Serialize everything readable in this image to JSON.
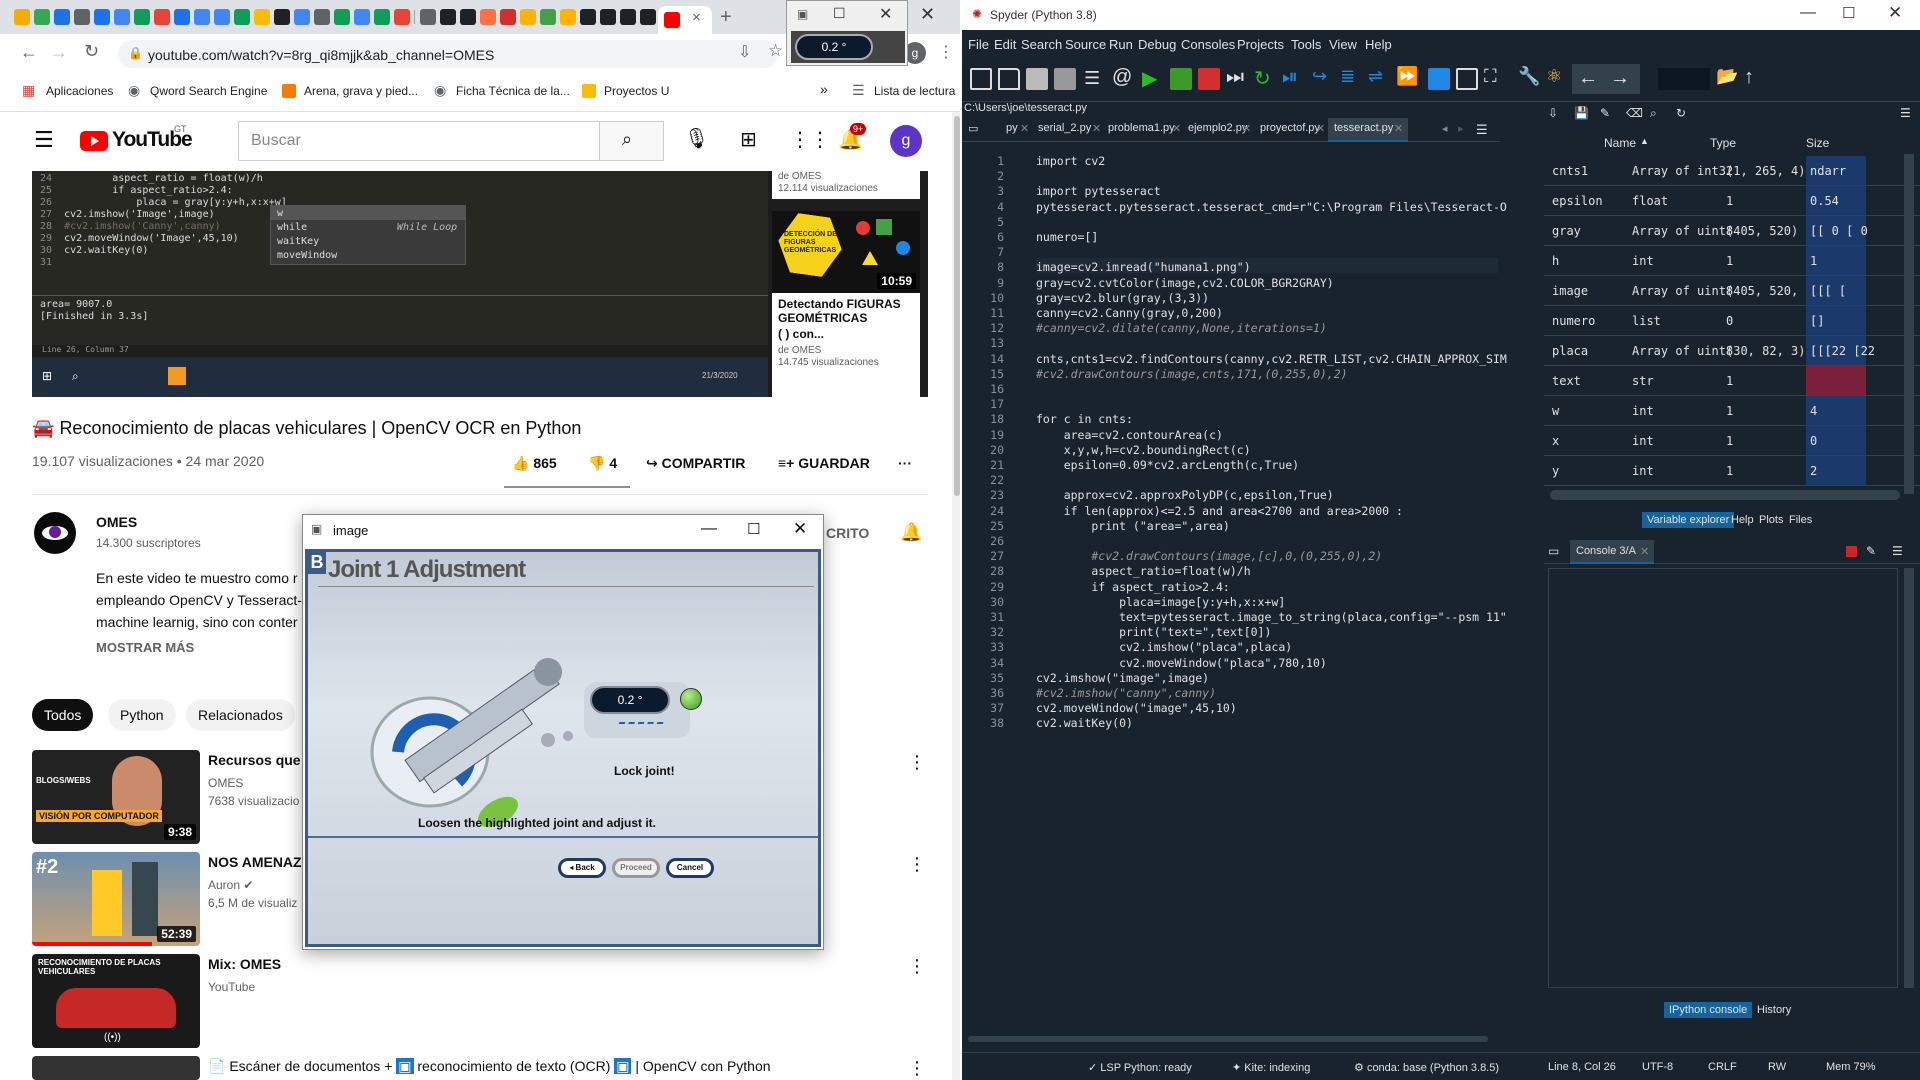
{
  "chrome": {
    "url": "youtube.com/watch?v=8rg_qi8mjjk&ab_channel=OMES",
    "bookmarks": [
      "Aplicaciones",
      "Qword Search Engine",
      "Arena, grava y pied...",
      "Ficha Técnica de la...",
      "Proyectos U",
      "Lista de lectura"
    ],
    "bookmarks_more": "»"
  },
  "youtube": {
    "logo": "YouTube",
    "logo_region": "GT",
    "search_placeholder": "Buscar",
    "notif_badge": "9+",
    "avatar_letter": "g",
    "video_title": "Reconocimiento de placas vehiculares | OpenCV OCR en Python",
    "views_date": "19.107 visualizaciones • 24 mar 2020",
    "likes": "865",
    "dislikes": "4",
    "share": "COMPARTIR",
    "save": "GUARDAR",
    "channel_name": "OMES",
    "subscribers": "14.300 suscriptores",
    "subscribe_tail": "CRITO",
    "description": [
      "En este video te muestro como r",
      "empleando OpenCV y Tesseract-",
      "machine learnig, sino con conter"
    ],
    "show_more": "MOSTRAR MÁS",
    "chips": [
      "Todos",
      "Python",
      "Relacionados"
    ],
    "video_editor": {
      "lines": [
        {
          "n": "24",
          "text": "        aspect_ratio = float(w)/h"
        },
        {
          "n": "25",
          "text": "        if aspect_ratio>2.4:"
        },
        {
          "n": "26",
          "text": "            placa = gray[y:y+h,x:x+w]"
        },
        {
          "n": "27",
          "text": "cv2.imshow('Image',image)"
        },
        {
          "n": "28",
          "text": "#cv2.imshow('Canny',canny)"
        },
        {
          "n": "29",
          "text": "cv2.moveWindow('Image',45,10)"
        },
        {
          "n": "30",
          "text": "cv2.waitKey(0)"
        },
        {
          "n": "31",
          "text": ""
        }
      ],
      "autocomplete": [
        "w",
        "while",
        "waitKey",
        "moveWindow"
      ],
      "autocomplete_hint": "While Loop",
      "console": [
        "area= 9007.0",
        "[Finished in 3.3s]"
      ],
      "status": "Line 26, Column 37",
      "clock": "21/3/2020"
    },
    "video_cards": [
      {
        "channel": "de OMES",
        "views": "12.114 visualizaciones"
      },
      {
        "title": "Detectando FIGURAS GEOMÉTRICAS",
        "title2": "( ) con...",
        "channel": "de OMES",
        "views": "14.745 visualizaciones",
        "duration": "10:59",
        "thumb_text": "DETECCIÓN DE FIGURAS GEOMÉTRICAS"
      }
    ],
    "recommendations": [
      {
        "title": "Recursos que l",
        "channel": "OMES",
        "meta": "7638 visualizacio",
        "duration": "9:38",
        "thumb_text": "VISIÓN POR COMPUTADOR"
      },
      {
        "title": "NOS AMENAZ",
        "channel": "Auron",
        "meta": "6,5 M de visualiz",
        "duration": "52:39",
        "thumb_text": "#2"
      },
      {
        "title": "Mix: OMES",
        "channel": "YouTube",
        "meta": "",
        "duration": "",
        "thumb_text": "RECONOCIMIENTO DE PLACAS VEHICULARES"
      },
      {
        "title": "Escáner de documentos + ",
        "title_mid": " reconocimiento de texto (OCR) ",
        "title_end": " | OpenCV con Python"
      }
    ]
  },
  "mini_window": {
    "readout": "0.2 °"
  },
  "image_window": {
    "title": "image",
    "step_letter": "B",
    "heading": "Joint 1 Adjustment",
    "readout": "0.2 °",
    "lock_text": "Lock joint!",
    "instruction": "Loosen the highlighted joint and adjust it.",
    "buttons": [
      "◂ Back",
      "Proceed",
      "Cancel"
    ]
  },
  "spyder": {
    "title": "Spyder (Python 3.8)",
    "menu": [
      "File",
      "Edit",
      "Search",
      "Source",
      "Run",
      "Debug",
      "Consoles",
      "Projects",
      "Tools",
      "View",
      "Help"
    ],
    "path": "C:\\Users\\joe\\tesseract.py",
    "tabs": [
      "py",
      "serial_2.py",
      "problema1.py",
      "ejemplo2.py",
      "proyectof.py",
      "tesseract.py"
    ],
    "code": [
      "import cv2",
      "",
      "import pytesseract",
      "pytesseract.pytesseract.tesseract_cmd=r\"C:\\Program Files\\Tesseract-O",
      "",
      "numero=[]",
      "",
      "image=cv2.imread(\"humana1.png\")",
      "gray=cv2.cvtColor(image,cv2.COLOR_BGR2GRAY)",
      "gray=cv2.blur(gray,(3,3))",
      "canny=cv2.Canny(gray,0,200)",
      "#canny=cv2.dilate(canny,None,iterations=1)",
      "",
      "cnts,cnts1=cv2.findContours(canny,cv2.RETR_LIST,cv2.CHAIN_APPROX_SIM",
      "#cv2.drawContours(image,cnts,171,(0,255,0),2)",
      "",
      "",
      "for c in cnts:",
      "    area=cv2.contourArea(c)",
      "    x,y,w,h=cv2.boundingRect(c)",
      "    epsilon=0.09*cv2.arcLength(c,True)",
      "",
      "    approx=cv2.approxPolyDP(c,epsilon,True)",
      "    if len(approx)<=2.5 and area<2700 and area>2000 :",
      "        print (\"area=\",area)",
      "",
      "        #cv2.drawContours(image,[c],0,(0,255,0),2)",
      "        aspect_ratio=float(w)/h",
      "        if aspect_ratio>2.4:",
      "            placa=image[y:y+h,x:x+w]",
      "            text=pytesseract.image_to_string(placa,config=\"--psm 11\"",
      "            print(\"text=\",text[0])",
      "            cv2.imshow(\"placa\",placa)",
      "            cv2.moveWindow(\"placa\",780,10)",
      "cv2.imshow(\"image\",image)",
      "#cv2.imshow(\"canny\",canny)",
      "cv2.moveWindow(\"image\",45,10)",
      "cv2.waitKey(0)"
    ],
    "var_headers": [
      "Name",
      "Type",
      "Size"
    ],
    "variables": [
      {
        "name": "cnts1",
        "type": "Array of int32",
        "size": "(1, 265, 4)",
        "value": "ndarr"
      },
      {
        "name": "epsilon",
        "type": "float",
        "size": "1",
        "value": "0.54"
      },
      {
        "name": "gray",
        "type": "Array of uint8",
        "size": "(405, 520)",
        "value": "[[ 0  [ 0"
      },
      {
        "name": "h",
        "type": "int",
        "size": "1",
        "value": "1"
      },
      {
        "name": "image",
        "type": "Array of uint8",
        "size": "(405, 520, 3)",
        "value": "[[[ ["
      },
      {
        "name": "numero",
        "type": "list",
        "size": "0",
        "value": "[]"
      },
      {
        "name": "placa",
        "type": "Array of uint8",
        "size": "(30, 82, 3)",
        "value": "[[[22 [22"
      },
      {
        "name": "text",
        "type": "str",
        "size": "1",
        "value": ""
      },
      {
        "name": "w",
        "type": "int",
        "size": "1",
        "value": "4"
      },
      {
        "name": "x",
        "type": "int",
        "size": "1",
        "value": "0"
      },
      {
        "name": "y",
        "type": "int",
        "size": "1",
        "value": "2"
      }
    ],
    "pane_tabs": [
      "Variable explorer",
      "Help",
      "Plots",
      "Files"
    ],
    "console_tab": "Console 3/A",
    "console_bottom_tabs": [
      "IPython console",
      "History"
    ],
    "status": [
      "LSP Python: ready",
      "Kite: indexing",
      "conda: base (Python 3.8.5)",
      "Line 8, Col 26",
      "UTF-8",
      "CRLF",
      "RW",
      "Mem 79%"
    ]
  }
}
